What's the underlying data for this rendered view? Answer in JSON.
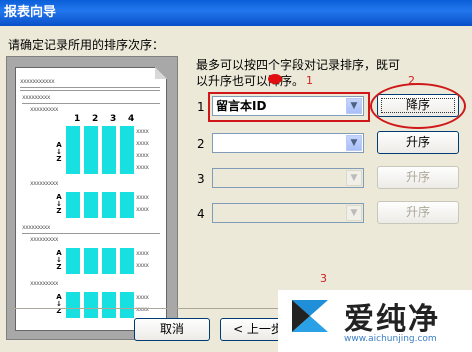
{
  "window": {
    "title": "报表向导"
  },
  "prompt": "请确定记录所用的排序次序：",
  "info": "最多可以按四个字段对记录排序，既可以升序也可以降序。",
  "preview": {
    "col_numbers": [
      "1",
      "2",
      "3",
      "4"
    ],
    "az_label": "A\nZ"
  },
  "annotations": {
    "step1": "1",
    "step2": "2",
    "step3": "3"
  },
  "sort_rows": [
    {
      "number": "1",
      "field": "留言本ID",
      "button": "降序",
      "enabled": true
    },
    {
      "number": "2",
      "field": "",
      "button": "升序",
      "enabled": true
    },
    {
      "number": "3",
      "field": "",
      "button": "升序",
      "enabled": false
    },
    {
      "number": "4",
      "field": "",
      "button": "升序",
      "enabled": false
    }
  ],
  "footer": {
    "cancel": "取消",
    "back": "< 上一步"
  },
  "watermark": {
    "text": "爱纯净",
    "url": "www.aichunjing.com"
  },
  "colors": {
    "highlight": "#19e0e0",
    "annotation_red": "#d01818",
    "title_blue": "#0a5fd8"
  }
}
